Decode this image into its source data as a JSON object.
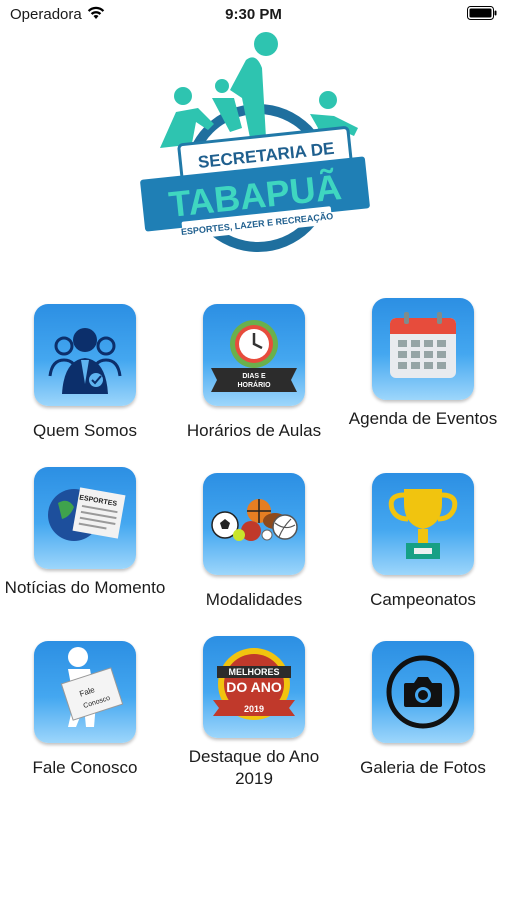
{
  "status_bar": {
    "carrier": "Operadora",
    "time": "9:30 PM"
  },
  "logo": {
    "line1": "SECRETARIA DE",
    "line2": "TABAPUÃ",
    "line3": "ESPORTES, LAZER E RECREAÇÃO"
  },
  "menu": [
    {
      "label": "Quem Somos",
      "icon": "people-group-icon"
    },
    {
      "label": "Horários de Aulas",
      "icon": "clock-icon",
      "badge_line1": "DIAS E",
      "badge_line2": "HORÁRIO"
    },
    {
      "label": "Agenda de Eventos",
      "icon": "calendar-icon"
    },
    {
      "label": "Notícias do Momento",
      "icon": "newspaper-globe-icon",
      "badge": "ESPORTES"
    },
    {
      "label": "Modalidades",
      "icon": "sports-balls-icon"
    },
    {
      "label": "Campeonatos",
      "icon": "trophy-icon"
    },
    {
      "label": "Fale Conosco",
      "icon": "person-envelope-icon",
      "badge_line1": "Fale",
      "badge_line2": "Conosco"
    },
    {
      "label": "Destaque do Ano 2019",
      "icon": "award-badge-icon",
      "badge_line1": "MELHORES",
      "badge_line2": "DO ANO",
      "badge_line3": "2019"
    },
    {
      "label": "Galeria de Fotos",
      "icon": "camera-icon"
    }
  ],
  "colors": {
    "tile_gradient_top": "#2c8fe3",
    "tile_gradient_bottom": "#9dd6fb",
    "logo_teal": "#2ec4b0",
    "logo_blue": "#2179a8"
  }
}
